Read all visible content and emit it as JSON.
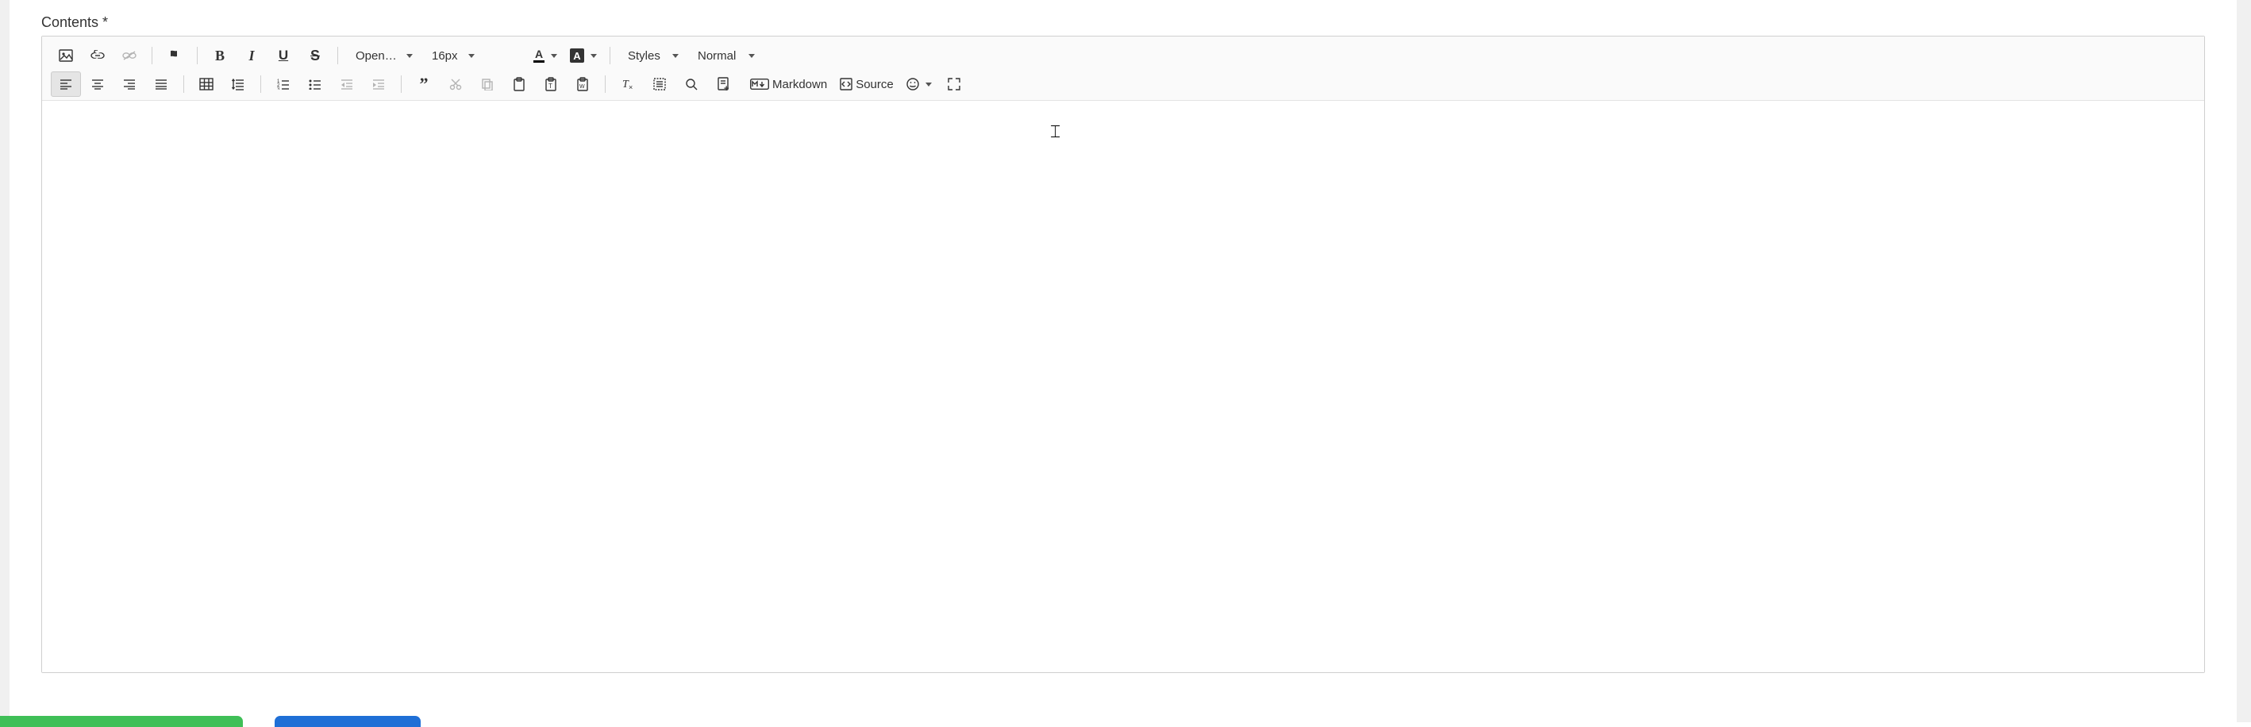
{
  "field": {
    "label": "Contents *"
  },
  "toolbar": {
    "font_family": "Open…",
    "font_size": "16px",
    "styles_label": "Styles",
    "format_label": "Normal",
    "markdown_label": "Markdown",
    "source_label": "Source",
    "text_color_letter": "A",
    "bg_color_letter": "A"
  }
}
